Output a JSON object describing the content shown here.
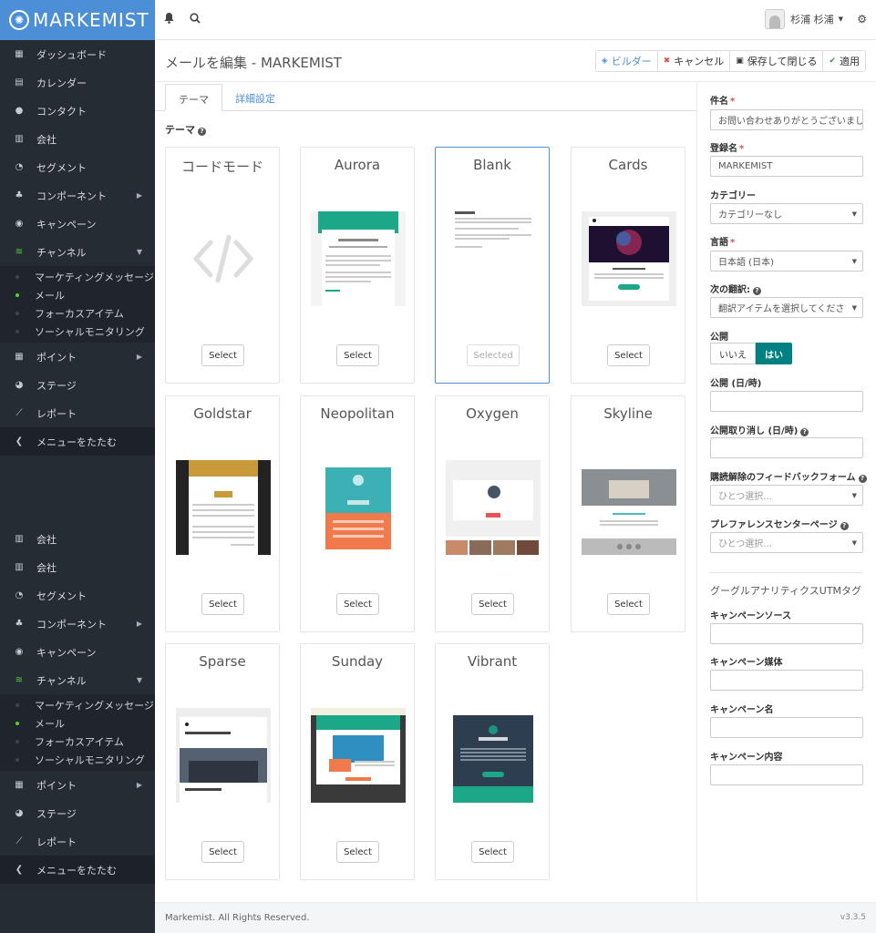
{
  "brand": {
    "name": "MARKEMIST"
  },
  "topbar": {
    "user_name": "杉浦 杉浦"
  },
  "sidebar": {
    "menu1": [
      {
        "icon": "dashboard-icon",
        "glyph": "▦",
        "label": "ダッシュボード"
      },
      {
        "icon": "calendar-icon",
        "glyph": "▤",
        "label": "カレンダー"
      },
      {
        "icon": "contact-icon",
        "glyph": "●",
        "label": "コンタクト"
      },
      {
        "icon": "company-icon",
        "glyph": "▥",
        "label": "会社"
      },
      {
        "icon": "segment-icon",
        "glyph": "◔",
        "label": "セグメント"
      },
      {
        "icon": "component-icon",
        "glyph": "♣",
        "label": "コンポーネント",
        "arrow": "right"
      },
      {
        "icon": "campaign-icon",
        "glyph": "◉",
        "label": "キャンペーン"
      },
      {
        "icon": "channel-icon",
        "glyph": "≋",
        "label": "チャンネル",
        "arrow": "down",
        "active": true
      }
    ],
    "sub1": [
      {
        "label": "マーケティングメッセージ"
      },
      {
        "label": "メール",
        "active": true
      },
      {
        "label": "フォーカスアイテム"
      },
      {
        "label": "ソーシャルモニタリング"
      }
    ],
    "menu1b": [
      {
        "icon": "points-icon",
        "glyph": "▦",
        "label": "ポイント",
        "arrow": "right"
      },
      {
        "icon": "stage-icon",
        "glyph": "◕",
        "label": "ステージ"
      },
      {
        "icon": "report-icon",
        "glyph": "⟋",
        "label": "レポート"
      }
    ],
    "collapse_label": "メニューをたたむ",
    "menu2": [
      {
        "icon": "company-icon",
        "glyph": "▥",
        "label": "会社"
      },
      {
        "icon": "company-icon",
        "glyph": "▥",
        "label": "会社"
      },
      {
        "icon": "segment-icon",
        "glyph": "◔",
        "label": "セグメント"
      },
      {
        "icon": "component-icon",
        "glyph": "♣",
        "label": "コンポーネント",
        "arrow": "right"
      },
      {
        "icon": "campaign-icon",
        "glyph": "◉",
        "label": "キャンペーン"
      },
      {
        "icon": "channel-icon",
        "glyph": "≋",
        "label": "チャンネル",
        "arrow": "down",
        "active": true
      }
    ],
    "sub2": [
      {
        "label": "マーケティングメッセージ"
      },
      {
        "label": "メール",
        "active": true
      },
      {
        "label": "フォーカスアイテム"
      },
      {
        "label": "ソーシャルモニタリング"
      }
    ],
    "menu2b": [
      {
        "icon": "points-icon",
        "glyph": "▦",
        "label": "ポイント",
        "arrow": "right"
      },
      {
        "icon": "stage-icon",
        "glyph": "◕",
        "label": "ステージ"
      },
      {
        "icon": "report-icon",
        "glyph": "⟋",
        "label": "レポート"
      }
    ]
  },
  "header": {
    "title": "メールを編集 - MARKEMIST"
  },
  "toolbar": {
    "builder": "ビルダー",
    "cancel": "キャンセル",
    "save_close": "保存して閉じる",
    "apply": "適用"
  },
  "tabs": {
    "theme": "テーマ",
    "advanced": "詳細設定"
  },
  "theme_label": "テーマ",
  "themes": [
    {
      "name": "コードモード",
      "button": "Select"
    },
    {
      "name": "Aurora",
      "button": "Select"
    },
    {
      "name": "Blank",
      "button": "Selected"
    },
    {
      "name": "Cards",
      "button": "Select"
    },
    {
      "name": "Goldstar",
      "button": "Select"
    },
    {
      "name": "Neopolitan",
      "button": "Select"
    },
    {
      "name": "Oxygen",
      "button": "Select"
    },
    {
      "name": "Skyline",
      "button": "Select"
    },
    {
      "name": "Sparse",
      "button": "Select"
    },
    {
      "name": "Sunday",
      "button": "Select"
    },
    {
      "name": "Vibrant",
      "button": "Select"
    }
  ],
  "form": {
    "subject_label": "件名",
    "subject_value": "お問い合わせありがとうございまし",
    "internal_name_label": "登録名",
    "internal_name_value": "MARKEMIST",
    "category_label": "カテゴリー",
    "category_value": "カテゴリーなし",
    "language_label": "言語",
    "language_value": "日本語 (日本)",
    "translation_label": "次の翻訳:",
    "translation_value": "翻訳アイテムを選択してくださ",
    "publish_label": "公開",
    "publish_no": "いいえ",
    "publish_yes": "はい",
    "publish_up_label": "公開 (日/時)",
    "publish_down_label": "公開取り消し (日/時)",
    "unsub_label": "購読解除のフィードバックフォーム",
    "unsub_placeholder": "ひとつ選択...",
    "pref_label": "プレファレンスセンターページ",
    "pref_placeholder": "ひとつ選択...",
    "utm_title": "グーグルアナリティクスUTMタグ",
    "utm_source_label": "キャンペーンソース",
    "utm_medium_label": "キャンペーン媒体",
    "utm_campaign_label": "キャンペーン名",
    "utm_content_label": "キャンペーン内容"
  },
  "footer": {
    "copyright": "Markemist. All Rights Reserved.",
    "version": "v3.3.5"
  }
}
